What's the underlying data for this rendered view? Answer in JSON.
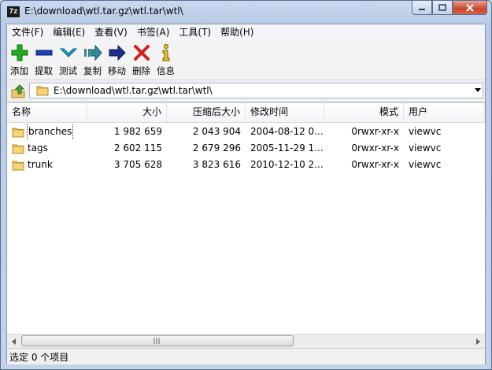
{
  "window": {
    "title": "E:\\download\\wtl.tar.gz\\wtl.tar\\wtl\\",
    "app_icon_text": "7z"
  },
  "menu": [
    "文件(F)",
    "编辑(E)",
    "查看(V)",
    "书签(A)",
    "工具(T)",
    "帮助(H)"
  ],
  "toolbar": [
    {
      "label": "添加",
      "icon": "add-icon",
      "color": "#1fae1f"
    },
    {
      "label": "提取",
      "icon": "extract-icon",
      "color": "#1a3fb4"
    },
    {
      "label": "测试",
      "icon": "test-icon",
      "color": "#1aa2c7"
    },
    {
      "label": "复制",
      "icon": "copy-icon",
      "color": "#2e8a9a"
    },
    {
      "label": "移动",
      "icon": "move-icon",
      "color": "#1f2f8a"
    },
    {
      "label": "删除",
      "icon": "delete-icon",
      "color": "#d41e1e"
    },
    {
      "label": "信息",
      "icon": "info-icon",
      "color": "#e8c81a"
    }
  ],
  "address": {
    "path": "E:\\download\\wtl.tar.gz\\wtl.tar\\wtl\\"
  },
  "columns": [
    "名称",
    "大小",
    "压缩后大小",
    "修改时间",
    "模式",
    "用户"
  ],
  "rows": [
    {
      "name": "branches",
      "size": "1 982 659",
      "packed": "2 043 904",
      "modified": "2004-08-12 0...",
      "mode": "0rwxr-xr-x",
      "user": "viewvc"
    },
    {
      "name": "tags",
      "size": "2 602 115",
      "packed": "2 679 296",
      "modified": "2005-11-29 1...",
      "mode": "0rwxr-xr-x",
      "user": "viewvc"
    },
    {
      "name": "trunk",
      "size": "3 705 628",
      "packed": "3 823 616",
      "modified": "2010-12-10 2...",
      "mode": "0rwxr-xr-x",
      "user": "viewvc"
    }
  ],
  "status": {
    "text": "选定 0 个项目"
  }
}
